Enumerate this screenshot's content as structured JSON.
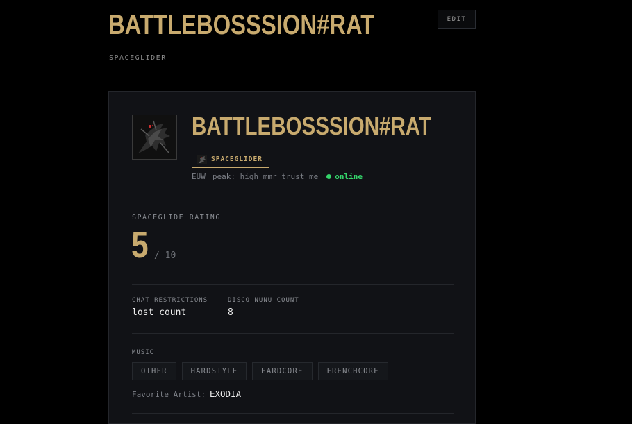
{
  "header": {
    "title": "BATTLEBOSSSION#RAT",
    "subtitle": "SPACEGLIDER",
    "edit_label": "EDIT"
  },
  "profile": {
    "name": "BATTLEBOSSSION#RAT",
    "rank_label": "SPACEGLIDER",
    "region": "EUW",
    "peak": "peak: high mmr trust me",
    "status": "online",
    "avatar": "dark-armored-character-avatar"
  },
  "rating": {
    "label": "SPACEGLIDE RATING",
    "value": "5",
    "max": "/ 10"
  },
  "stats": [
    {
      "label": "CHAT RESTRICTIONS",
      "value": "lost count"
    },
    {
      "label": "DISCO NUNU COUNT",
      "value": "8"
    }
  ],
  "music": {
    "label": "MUSIC",
    "tags": [
      "OTHER",
      "HARDSTYLE",
      "HARDCORE",
      "FRENCHCORE"
    ],
    "favorite_label": "Favorite Artist:",
    "favorite_artist": "EXODIA"
  },
  "colors": {
    "accent": "#c8aa6e",
    "background": "#000000",
    "card": "#111216",
    "online": "#34d46a"
  }
}
